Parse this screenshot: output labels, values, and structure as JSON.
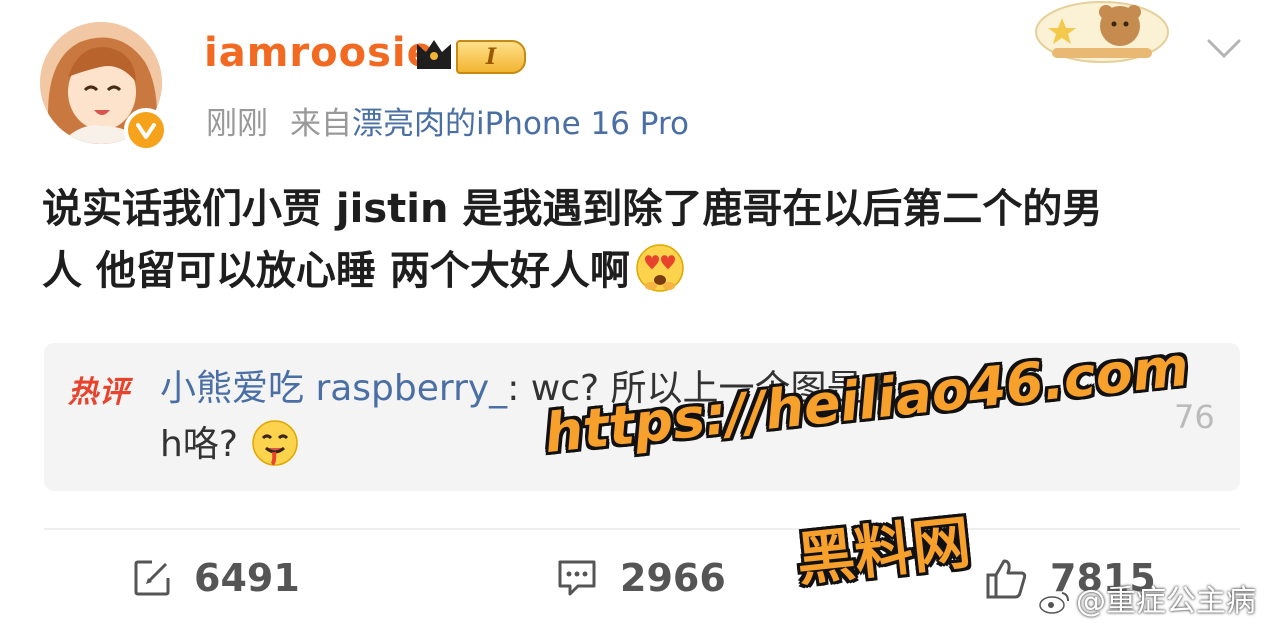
{
  "post": {
    "username": "iamroosie",
    "level_badge": "I",
    "time": "刚刚",
    "source_prefix": "来自",
    "source": "漂亮肉的iPhone 16 Pro",
    "text_line1": "说实话我们小贾 jistin 是我遇到除了鹿哥在以后第二个的男",
    "text_line2": "人 他留可以放心睡 两个大好人啊",
    "emoji_main": "heart-eyes-emoji"
  },
  "hot_comment": {
    "tag": "热评",
    "user": "小熊爱吃 raspberry_",
    "text_part1": ": wc?  所以上一个图是 l",
    "text_part2": "h咯?",
    "likes_partial": "76",
    "emoji": "drooling-face-emoji"
  },
  "actions": {
    "repost_count": "6491",
    "comment_count": "2966",
    "like_count": "7815"
  },
  "overlay": {
    "url": "https://heiliao46.com",
    "sub": "黑料网"
  },
  "watermark": "@重症公主病",
  "colors": {
    "username": "#f26a21",
    "link": "#4a6fa5",
    "hot_tag": "#e8432c",
    "overlay": "#f7a02b"
  }
}
